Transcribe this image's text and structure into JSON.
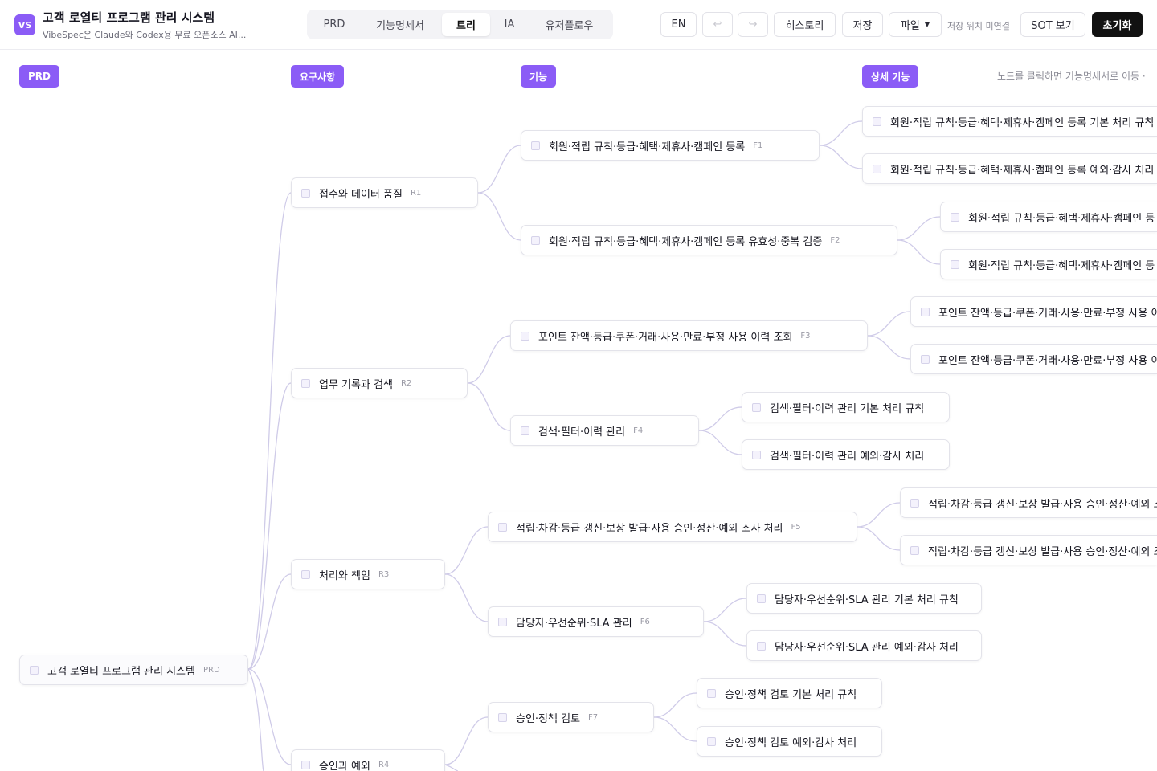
{
  "header": {
    "logo": "VS",
    "title": "고객 로열티 프로그램 관리 시스템",
    "subtitle": "VibeSpec은 Claude와 Codex용 무료 오픈소스 AI...",
    "tabs": [
      "PRD",
      "기능명세서",
      "트리",
      "IA",
      "유저플로우"
    ],
    "active_tab": "트리",
    "lang_button": "EN",
    "undo_icon": "undo-icon",
    "redo_icon": "redo-icon",
    "history_button": "히스토리",
    "save_button": "저장",
    "file_button": "파일",
    "save_location_status": "저장 위치 미연결",
    "sot_button": "SOT 보기",
    "reset_button": "초기화"
  },
  "canvas": {
    "columns": [
      "PRD",
      "요구사항",
      "기능",
      "상세 기능"
    ],
    "hint": "노드를 클릭하면 기능명세서로 이동 ·",
    "root": {
      "label": "고객 로열티 프로그램 관리 시스템",
      "code": "PRD"
    },
    "requirements": [
      {
        "label": "접수와 데이터 품질",
        "code": "R1"
      },
      {
        "label": "업무 기록과 검색",
        "code": "R2"
      },
      {
        "label": "처리와 책임",
        "code": "R3"
      },
      {
        "label": "승인과 예외",
        "code": "R4"
      }
    ],
    "features": [
      {
        "label": "회원·적립 규칙·등급·혜택·제휴사·캠페인 등록",
        "code": "F1"
      },
      {
        "label": "회원·적립 규칙·등급·혜택·제휴사·캠페인 등록 유효성·중복 검증",
        "code": "F2"
      },
      {
        "label": "포인트 잔액·등급·쿠폰·거래·사용·만료·부정 사용 이력 조회",
        "code": "F3"
      },
      {
        "label": "검색·필터·이력 관리",
        "code": "F4"
      },
      {
        "label": "적립·차감·등급 갱신·보상 발급·사용 승인·정산·예외 조사 처리",
        "code": "F5"
      },
      {
        "label": "담당자·우선순위·SLA 관리",
        "code": "F6"
      },
      {
        "label": "승인·정책 검토",
        "code": "F7"
      }
    ],
    "details": [
      {
        "label": "회원·적립 규칙·등급·혜택·제휴사·캠페인 등록 기본 처리 규칙"
      },
      {
        "label": "회원·적립 규칙·등급·혜택·제휴사·캠페인 등록 예외·감사 처리"
      },
      {
        "label": "회원·적립 규칙·등급·혜택·제휴사·캠페인 등"
      },
      {
        "label": "회원·적립 규칙·등급·혜택·제휴사·캠페인 등"
      },
      {
        "label": "포인트 잔액·등급·쿠폰·거래·사용·만료·부정 사용 이"
      },
      {
        "label": "포인트 잔액·등급·쿠폰·거래·사용·만료·부정 사용 이"
      },
      {
        "label": "검색·필터·이력 관리 기본 처리 규칙"
      },
      {
        "label": "검색·필터·이력 관리 예외·감사 처리"
      },
      {
        "label": "적립·차감·등급 갱신·보상 발급·사용 승인·정산·예외 조"
      },
      {
        "label": "적립·차감·등급 갱신·보상 발급·사용 승인·정산·예외 조"
      },
      {
        "label": "담당자·우선순위·SLA 관리 기본 처리 규칙"
      },
      {
        "label": "담당자·우선순위·SLA 관리 예외·감사 처리"
      },
      {
        "label": "승인·정책 검토 기본 처리 규칙"
      },
      {
        "label": "승인·정책 검토 예외·감사 처리"
      }
    ]
  }
}
